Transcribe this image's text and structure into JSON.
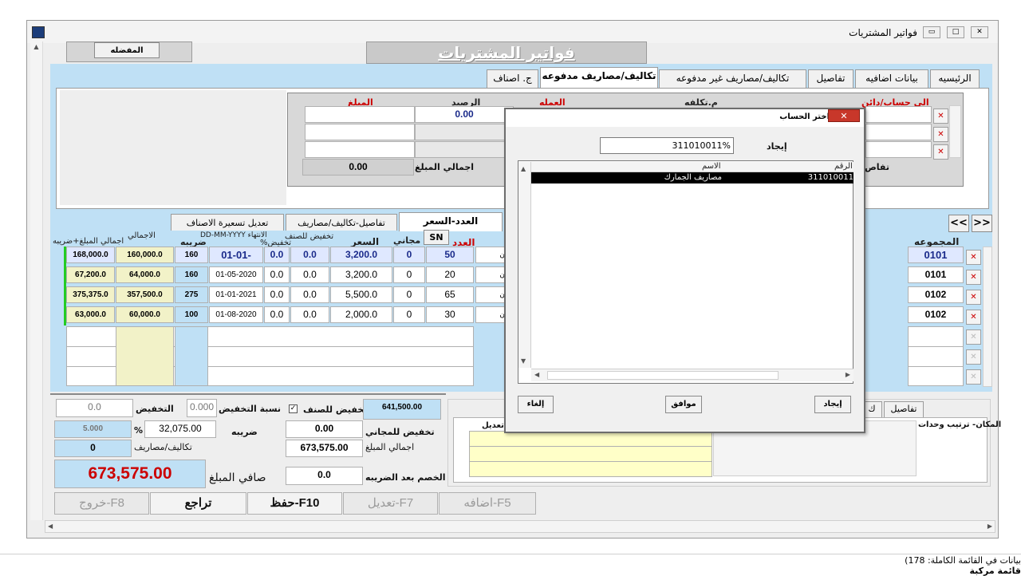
{
  "window": {
    "title": "فواتير المشتريات",
    "controls": [
      "▭",
      "□",
      "✕"
    ]
  },
  "header": {
    "favorites_label": "المفضله",
    "page_title": "فواتير المشتريات"
  },
  "tabs": [
    {
      "label": "الرئيسيه",
      "active": false
    },
    {
      "label": "بيانات اضافيه",
      "active": false
    },
    {
      "label": "تفاصيل",
      "active": false
    },
    {
      "label": "تكاليف/مصاريف غير مدفوعه",
      "active": false
    },
    {
      "label": "تكاليف/مصاريف مدفوعه",
      "active": true
    },
    {
      "label": "ج. اصناف",
      "active": false
    }
  ],
  "costs_grid": {
    "headers": {
      "account": "الى حساب/دائن",
      "cost_center": "م.تكلفه",
      "currency": "العمله",
      "balance": "الرصيد",
      "amount": "المبلغ"
    },
    "balance_value": "0.00",
    "total_label": "اجمالي المبلغ",
    "total_value": "0.00",
    "side_label": "تفاص"
  },
  "subtabs": [
    {
      "label": "العدد-السعر",
      "active": true
    },
    {
      "label": "تفاصيل-تكاليف/مصاريف",
      "active": false
    },
    {
      "label": "تعديل تسعيرة الاصناف",
      "active": false
    }
  ],
  "nav_buttons": {
    "next": ">>",
    "prev": "<<"
  },
  "items_grid": {
    "headers": {
      "group": "المجموعه",
      "qty": "العدد",
      "sn": "SN",
      "free": "مجاني",
      "price": "السعر",
      "discount_item": "تخفيض للصنف",
      "discount_pct": "تخفيض%",
      "expiry": "الانتهاء DD-MM-YYYY",
      "tax": "ضريبه",
      "total": "الاجمالي",
      "total_tax": "اجمالي المبلغ+ضريبه"
    },
    "rows": [
      {
        "group": "0101",
        "store": "ن الرئيسي",
        "qty": "50",
        "free": "0",
        "price": "3,200.0",
        "disc": "0.0",
        "pct": "0.0",
        "expiry": "01-01-2020",
        "tax": "160",
        "total": "160,000.0",
        "total_tax": "168,000.0"
      },
      {
        "group": "0101",
        "store": "ن الرئيسي",
        "qty": "20",
        "free": "0",
        "price": "3,200.0",
        "disc": "0.0",
        "pct": "0.0",
        "expiry": "01-05-2020",
        "tax": "160",
        "total": "64,000.0",
        "total_tax": "67,200.0"
      },
      {
        "group": "0102",
        "store": "ن الرئيسي",
        "qty": "65",
        "free": "0",
        "price": "5,500.0",
        "disc": "0.0",
        "pct": "0.0",
        "expiry": "01-01-2021",
        "tax": "275",
        "total": "357,500.0",
        "total_tax": "375,375.0"
      },
      {
        "group": "0102",
        "store": "ن الرئيسي",
        "qty": "30",
        "free": "0",
        "price": "2,000.0",
        "disc": "0.0",
        "pct": "0.0",
        "expiry": "01-08-2020",
        "tax": "100",
        "total": "60,000.0",
        "total_tax": "63,000.0"
      }
    ]
  },
  "totals": {
    "discount_label": "التخفيض",
    "discount_value": "0.0",
    "discount_rate_label": "نسبة التخفيض",
    "discount_rate_value": "0.000",
    "item_discount_label": "تخفيض للصنف",
    "gross_value": "641,500.00",
    "tax_pct_value": "5.000",
    "pct_symbol": "%",
    "tax_label": "ضريبه",
    "tax_value": "32,075.00",
    "free_discount_label": "تخفيض للمجاني",
    "free_discount_value": "0.00",
    "costs_label": "تكاليف/مصاريف",
    "costs_value": "0",
    "total_amount_label": "اجمالي المبلغ",
    "total_amount_value": "673,575.00",
    "net_label": "صافي المبلغ",
    "net_value": "673,575.00",
    "after_tax_label": "الخصم بعد الضريبه",
    "after_tax_value": "0.0"
  },
  "lower_right": {
    "tabs": [
      "تفاصيل",
      "ك"
    ],
    "place_label": "المكان- ترتيب وحدات",
    "edit_label": "تعديل"
  },
  "bottom_buttons": [
    {
      "label": "اضافه-F5",
      "enabled": false
    },
    {
      "label": "تعديل-F7",
      "enabled": false
    },
    {
      "label": "حفظ-F10",
      "enabled": true
    },
    {
      "label": "تراجع",
      "enabled": true
    },
    {
      "label": "خروج-F8",
      "enabled": false
    }
  ],
  "dialog": {
    "title": "اختر الحساب",
    "close": "✕",
    "find_label": "إيجاد",
    "search_value": "311010011%",
    "col_number": "الرقم",
    "col_name": "الاسم",
    "row_number": "311010011",
    "row_name": "مصاريف الجمارك",
    "ok_label": "موافق",
    "cancel_label": "إلغاء",
    "find_button": "إيجاد"
  },
  "status_bar": {
    "records": "بيانات في القائمة الكاملة: 178)",
    "mode": "قائمة مركبة"
  }
}
